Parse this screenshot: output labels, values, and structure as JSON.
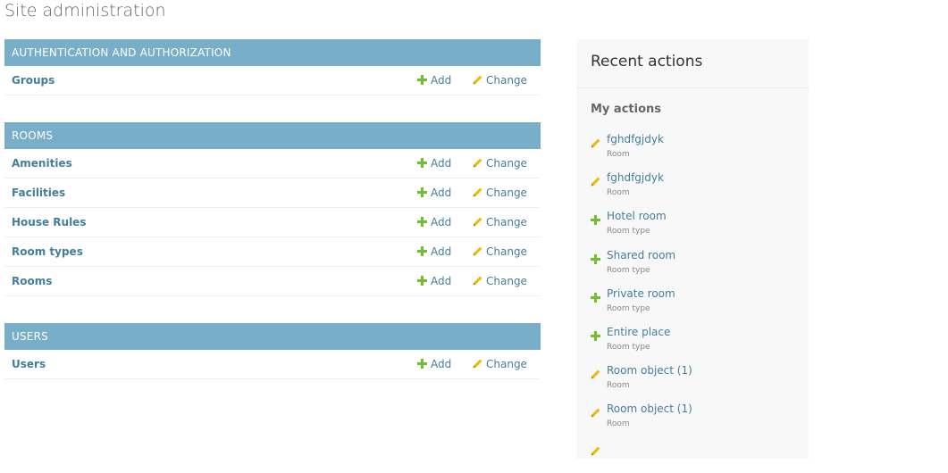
{
  "page": {
    "title": "Site administration"
  },
  "modules": [
    {
      "header": "AUTHENTICATION AND AUTHORIZATION",
      "models": [
        {
          "name": "Groups",
          "add": "Add",
          "change": "Change"
        }
      ]
    },
    {
      "header": "ROOMS",
      "models": [
        {
          "name": "Amenities",
          "add": "Add",
          "change": "Change"
        },
        {
          "name": "Facilities",
          "add": "Add",
          "change": "Change"
        },
        {
          "name": "House Rules",
          "add": "Add",
          "change": "Change"
        },
        {
          "name": "Room types",
          "add": "Add",
          "change": "Change"
        },
        {
          "name": "Rooms",
          "add": "Add",
          "change": "Change"
        }
      ]
    },
    {
      "header": "USERS",
      "models": [
        {
          "name": "Users",
          "add": "Add",
          "change": "Change"
        }
      ]
    }
  ],
  "recent": {
    "title": "Recent actions",
    "subtitle": "My actions",
    "items": [
      {
        "icon": "pencil-icon",
        "name": "fghdfgjdyk",
        "type": "Room"
      },
      {
        "icon": "pencil-icon",
        "name": "fghdfgjdyk",
        "type": "Room"
      },
      {
        "icon": "plus-icon",
        "name": "Hotel room",
        "type": "Room type"
      },
      {
        "icon": "plus-icon",
        "name": "Shared room",
        "type": "Room type"
      },
      {
        "icon": "plus-icon",
        "name": "Private room",
        "type": "Room type"
      },
      {
        "icon": "plus-icon",
        "name": "Entire place",
        "type": "Room type"
      },
      {
        "icon": "pencil-icon",
        "name": "Room object (1)",
        "type": "Room"
      },
      {
        "icon": "pencil-icon",
        "name": "Room object (1)",
        "type": "Room"
      },
      {
        "icon": "pencil-icon",
        "name": "",
        "type": ""
      }
    ]
  },
  "colors": {
    "header_bg": "#79aec8",
    "link": "#447e9b",
    "add_green": "#70bf2b",
    "change_yellow": "#efb80b"
  }
}
